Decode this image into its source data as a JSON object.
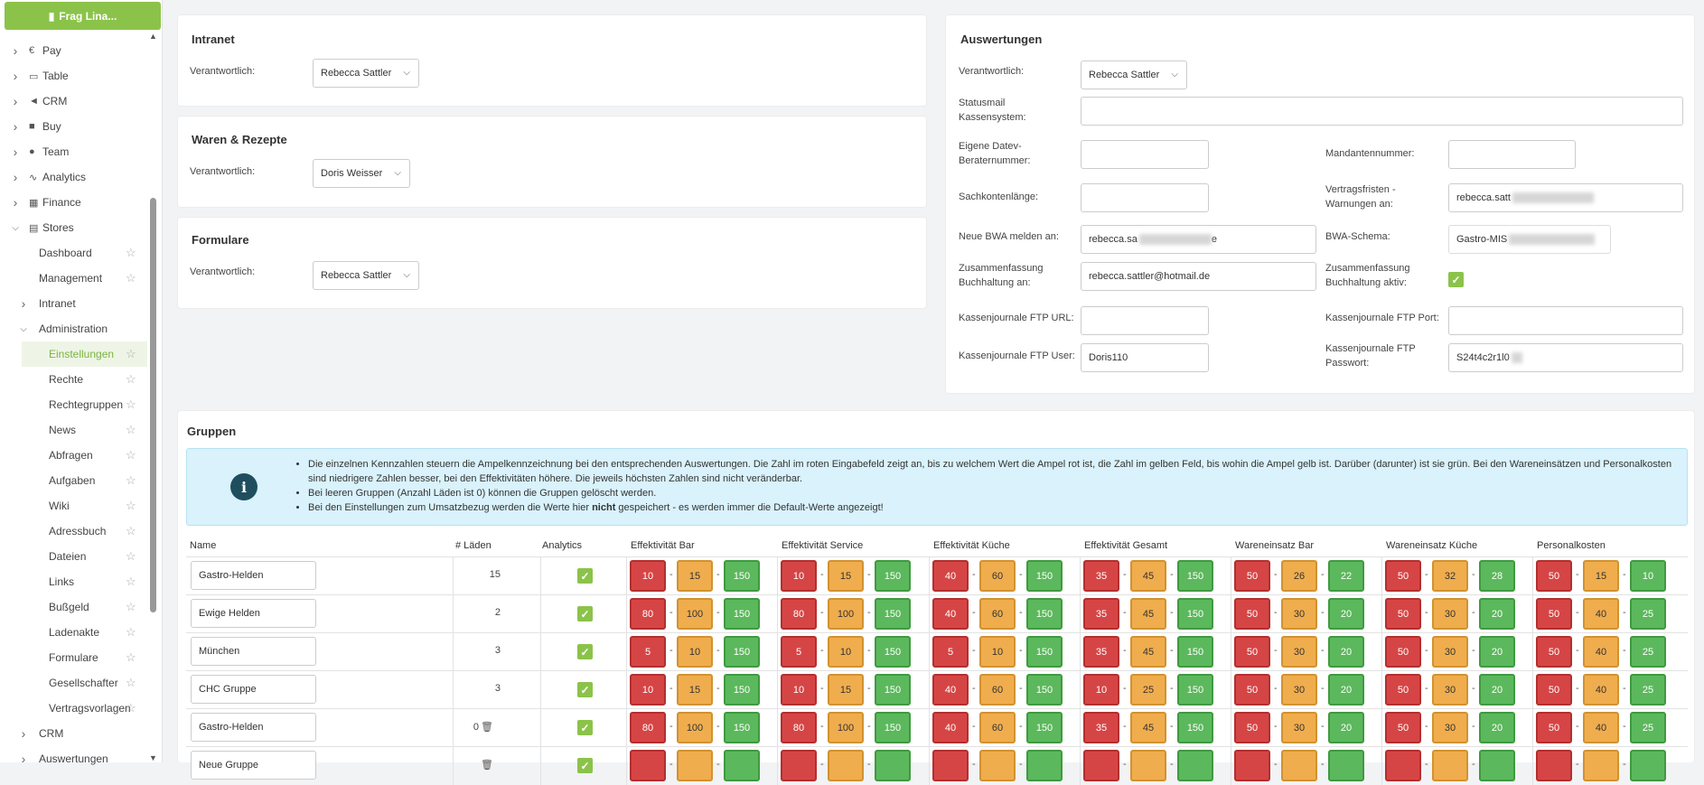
{
  "sidebar": {
    "ask_button": "Frag Lina...",
    "items": [
      {
        "label": "Pay",
        "icon": "euro-icon",
        "glyph": "€",
        "level": 0,
        "chevron": "right"
      },
      {
        "label": "Table",
        "icon": "book-icon",
        "glyph": "▭",
        "level": 0,
        "chevron": "right"
      },
      {
        "label": "CRM",
        "icon": "megaphone-icon",
        "glyph": "◄",
        "level": 0,
        "chevron": "right"
      },
      {
        "label": "Buy",
        "icon": "truck-icon",
        "glyph": "■",
        "level": 0,
        "chevron": "right"
      },
      {
        "label": "Team",
        "icon": "users-icon",
        "glyph": "●",
        "level": 0,
        "chevron": "right"
      },
      {
        "label": "Analytics",
        "icon": "chart-icon",
        "glyph": "∿",
        "level": 0,
        "chevron": "right"
      },
      {
        "label": "Finance",
        "icon": "calculator-icon",
        "glyph": "▦",
        "level": 0,
        "chevron": "right"
      },
      {
        "label": "Stores",
        "icon": "store-icon",
        "glyph": "▤",
        "level": 0,
        "chevron": "down"
      },
      {
        "label": "Dashboard",
        "level": 1,
        "star": true
      },
      {
        "label": "Management",
        "level": 1,
        "star": true
      },
      {
        "label": "Intranet",
        "level": 1,
        "chevron": "right"
      },
      {
        "label": "Administration",
        "level": 1,
        "chevron": "down"
      },
      {
        "label": "Einstellungen",
        "level": 2,
        "star": true,
        "active": true
      },
      {
        "label": "Rechte",
        "level": 2,
        "star": true
      },
      {
        "label": "Rechtegruppen",
        "level": 2,
        "star": true
      },
      {
        "label": "News",
        "level": 2,
        "star": true
      },
      {
        "label": "Abfragen",
        "level": 2,
        "star": true
      },
      {
        "label": "Aufgaben",
        "level": 2,
        "star": true
      },
      {
        "label": "Wiki",
        "level": 2,
        "star": true
      },
      {
        "label": "Adressbuch",
        "level": 2,
        "star": true
      },
      {
        "label": "Dateien",
        "level": 2,
        "star": true
      },
      {
        "label": "Links",
        "level": 2,
        "star": true
      },
      {
        "label": "Bußgeld",
        "level": 2,
        "star": true
      },
      {
        "label": "Ladenakte",
        "level": 2,
        "star": true
      },
      {
        "label": "Formulare",
        "level": 2,
        "star": true
      },
      {
        "label": "Gesellschafter",
        "level": 2,
        "star": true
      },
      {
        "label": "Vertragsvorlagen",
        "level": 2,
        "star": true
      },
      {
        "label": "CRM",
        "level": 1,
        "chevron": "right"
      },
      {
        "label": "Auswertungen",
        "level": 1,
        "chevron": "right"
      }
    ]
  },
  "intranet": {
    "title": "Intranet",
    "label": "Verantwortlich:",
    "value": "Rebecca Sattler"
  },
  "waren": {
    "title": "Waren & Rezepte",
    "label": "Verantwortlich:",
    "value": "Doris Weisser"
  },
  "formulare": {
    "title": "Formulare",
    "label": "Verantwortlich:",
    "value": "Rebecca Sattler"
  },
  "auswertungen": {
    "title": "Auswertungen",
    "verantwortlich_label": "Verantwortlich:",
    "verantwortlich_value": "Rebecca Sattler",
    "statusmail_label": "Statusmail Kassensystem:",
    "statusmail_value": "",
    "datev_label": "Eigene Datev-Beraternummer:",
    "datev_value": "",
    "mandanten_label": "Mandantennummer:",
    "mandanten_value": "",
    "sachkonten_label": "Sachkontenlänge:",
    "sachkonten_value": "",
    "vertragsfristen_label": "Vertragsfristen - Warnungen an:",
    "vertragsfristen_value": "rebecca.satt",
    "bwa_label": "Neue BWA melden an:",
    "bwa_value": "rebecca.sa",
    "bwa_value_tail": "e",
    "bwa_schema_label": "BWA-Schema:",
    "bwa_schema_value": "Gastro-MIS",
    "zusammenfassung_label": "Zusammenfassung Buchhaltung an:",
    "zusammenfassung_value": "rebecca.sattler@hotmail.de",
    "zusammenfassung_aktiv_label": "Zusammenfassung Buchhaltung aktiv:",
    "zusammenfassung_aktiv": true,
    "ftp_url_label": "Kassenjournale FTP URL:",
    "ftp_url_value": "",
    "ftp_port_label": "Kassenjournale FTP Port:",
    "ftp_port_value": "",
    "ftp_user_label": "Kassenjournale FTP User:",
    "ftp_user_value": "Doris110",
    "ftp_pass_label": "Kassenjournale FTP Passwort:",
    "ftp_pass_value": "S24t4c2r1l0"
  },
  "gruppen": {
    "title": "Gruppen",
    "info": [
      "Die einzelnen Kennzahlen steuern die Ampelkennzeichnung bei den entsprechenden Auswertungen. Die Zahl im roten Eingabefeld zeigt an, bis zu welchem Wert die Ampel rot ist, die Zahl im gelben Feld, bis wohin die Ampel gelb ist. Darüber (darunter) ist sie grün. Bei den Wareneinsätzen und Personalkosten sind niedrigere Zahlen besser, bei den Effektivitäten höhere. Die jeweils höchsten Zahlen sind nicht veränderbar.",
      "Bei leeren Gruppen (Anzahl Läden ist 0) können die Gruppen gelöscht werden."
    ],
    "info3_pre": "Bei den Einstellungen zum Umsatzbezug werden die Werte hier ",
    "info3_bold": "nicht",
    "info3_post": " gespeichert - es werden immer die Default-Werte angezeigt!",
    "headers": {
      "name": "Name",
      "laeden": "# Läden",
      "analytics": "Analytics",
      "metrics": [
        "Effektivität Bar",
        "Effektivität Service",
        "Effektivität Küche",
        "Effektivität Gesamt",
        "Wareneinsatz Bar",
        "Wareneinsatz Küche",
        "Personalkosten"
      ]
    },
    "rows": [
      {
        "name": "Gastro-Helden",
        "laeden": "15",
        "analytics": true,
        "trash": false,
        "vals": [
          [
            "10",
            "15",
            "150"
          ],
          [
            "10",
            "15",
            "150"
          ],
          [
            "40",
            "60",
            "150"
          ],
          [
            "35",
            "45",
            "150"
          ],
          [
            "50",
            "26",
            "22"
          ],
          [
            "50",
            "32",
            "28"
          ],
          [
            "50",
            "15",
            "10"
          ]
        ]
      },
      {
        "name": "Ewige Helden",
        "laeden": "2",
        "analytics": true,
        "trash": false,
        "vals": [
          [
            "80",
            "100",
            "150"
          ],
          [
            "80",
            "100",
            "150"
          ],
          [
            "40",
            "60",
            "150"
          ],
          [
            "35",
            "45",
            "150"
          ],
          [
            "50",
            "30",
            "20"
          ],
          [
            "50",
            "30",
            "20"
          ],
          [
            "50",
            "40",
            "25"
          ]
        ]
      },
      {
        "name": "München",
        "laeden": "3",
        "analytics": true,
        "trash": false,
        "vals": [
          [
            "5",
            "10",
            "150"
          ],
          [
            "5",
            "10",
            "150"
          ],
          [
            "5",
            "10",
            "150"
          ],
          [
            "35",
            "45",
            "150"
          ],
          [
            "50",
            "30",
            "20"
          ],
          [
            "50",
            "30",
            "20"
          ],
          [
            "50",
            "40",
            "25"
          ]
        ]
      },
      {
        "name": "CHC Gruppe",
        "laeden": "3",
        "analytics": true,
        "trash": false,
        "vals": [
          [
            "10",
            "15",
            "150"
          ],
          [
            "10",
            "15",
            "150"
          ],
          [
            "40",
            "60",
            "150"
          ],
          [
            "10",
            "25",
            "150"
          ],
          [
            "50",
            "30",
            "20"
          ],
          [
            "50",
            "30",
            "20"
          ],
          [
            "50",
            "40",
            "25"
          ]
        ]
      },
      {
        "name": "Gastro-Helden",
        "laeden": "0",
        "analytics": true,
        "trash": true,
        "vals": [
          [
            "80",
            "100",
            "150"
          ],
          [
            "80",
            "100",
            "150"
          ],
          [
            "40",
            "60",
            "150"
          ],
          [
            "35",
            "45",
            "150"
          ],
          [
            "50",
            "30",
            "20"
          ],
          [
            "50",
            "30",
            "20"
          ],
          [
            "50",
            "40",
            "25"
          ]
        ]
      },
      {
        "name": "Neue Gruppe",
        "laeden": "",
        "analytics": true,
        "trash": true,
        "vals": [
          [
            "",
            "",
            ""
          ],
          [
            "",
            "",
            ""
          ],
          [
            "",
            "",
            ""
          ],
          [
            "",
            "",
            ""
          ],
          [
            "",
            "",
            ""
          ],
          [
            "",
            "",
            ""
          ],
          [
            "",
            "",
            ""
          ]
        ]
      }
    ]
  }
}
